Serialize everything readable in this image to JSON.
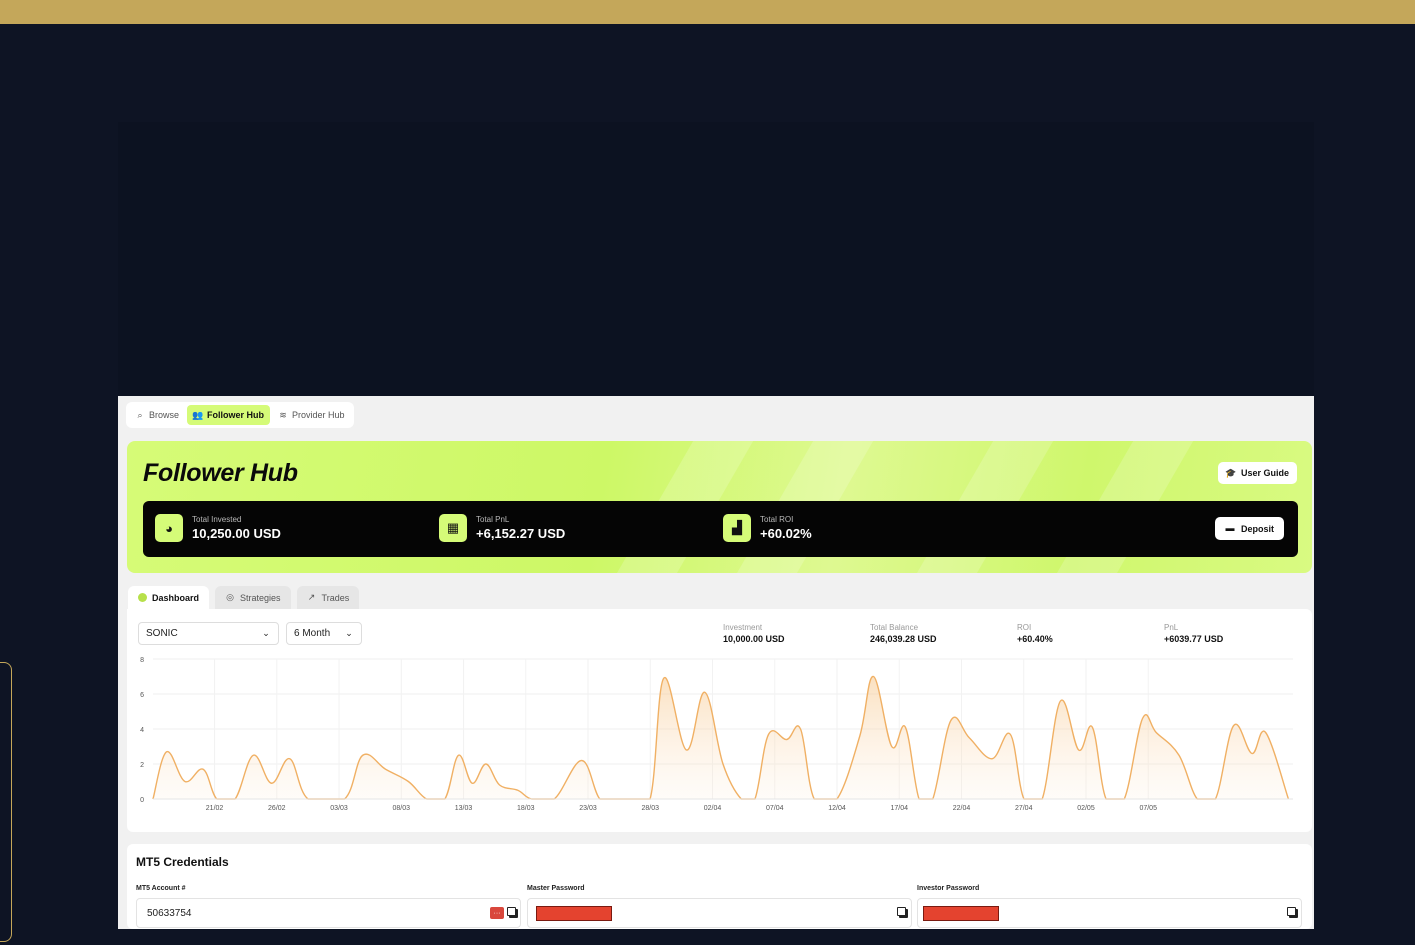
{
  "nav": {
    "tabs": [
      {
        "label": "Browse",
        "icon": "search-icon"
      },
      {
        "label": "Follower Hub",
        "icon": "users-icon"
      },
      {
        "label": "Provider Hub",
        "icon": "signal-icon"
      }
    ],
    "active_tab": "Follower Hub"
  },
  "hero": {
    "title": "Follower Hub",
    "guide_label": "User Guide",
    "deposit_label": "Deposit",
    "stats": [
      {
        "label": "Total Invested",
        "value": "10,250.00 USD",
        "icon": "pie-chart-icon"
      },
      {
        "label": "Total PnL",
        "value": "+6,152.27 USD",
        "icon": "calculator-icon"
      },
      {
        "label": "Total ROI",
        "value": "+60.02%",
        "icon": "bar-chart-icon"
      }
    ]
  },
  "subtabs": [
    {
      "label": "Dashboard",
      "icon": "dashboard-icon"
    },
    {
      "label": "Strategies",
      "icon": "target-icon"
    },
    {
      "label": "Trades",
      "icon": "trend-icon"
    }
  ],
  "dashboard": {
    "strategy_select": "SONIC",
    "period_select": "6 Month",
    "metrics": [
      {
        "label": "Investment",
        "value": "10,000.00 USD"
      },
      {
        "label": "Total Balance",
        "value": "246,039.28 USD"
      },
      {
        "label": "ROI",
        "value": "+60.40%"
      },
      {
        "label": "PnL",
        "value": "+6039.77 USD"
      }
    ]
  },
  "chart_data": {
    "type": "area",
    "y_ticks": [
      "0",
      "2",
      "4",
      "6",
      "8"
    ],
    "ylim": [
      0,
      8
    ],
    "x_ticks": [
      "21/02",
      "26/02",
      "03/03",
      "08/03",
      "13/03",
      "18/03",
      "23/03",
      "28/03",
      "02/04",
      "07/04",
      "12/04",
      "17/04",
      "22/04",
      "27/04",
      "02/05",
      "07/05"
    ],
    "grid": true,
    "color": "#f0b064",
    "points": [
      [
        0,
        0
      ],
      [
        0.3,
        2.7
      ],
      [
        0.7,
        1.0
      ],
      [
        1.1,
        1.7
      ],
      [
        1.4,
        0
      ],
      [
        1.8,
        0
      ],
      [
        2.2,
        2.5
      ],
      [
        2.6,
        0.9
      ],
      [
        3.0,
        2.3
      ],
      [
        3.4,
        0
      ],
      [
        4.2,
        0
      ],
      [
        4.6,
        2.5
      ],
      [
        5.1,
        1.7
      ],
      [
        5.6,
        1.0
      ],
      [
        6.0,
        0
      ],
      [
        6.4,
        0
      ],
      [
        6.7,
        2.5
      ],
      [
        7.0,
        0.9
      ],
      [
        7.3,
        2.0
      ],
      [
        7.6,
        0.8
      ],
      [
        8.0,
        0.5
      ],
      [
        8.3,
        0
      ],
      [
        8.8,
        0
      ],
      [
        9.4,
        2.2
      ],
      [
        9.8,
        0
      ],
      [
        10.2,
        0
      ],
      [
        10.4,
        0
      ],
      [
        10.9,
        0
      ],
      [
        11.2,
        6.9
      ],
      [
        11.7,
        2.8
      ],
      [
        12.1,
        6.1
      ],
      [
        12.5,
        2.0
      ],
      [
        12.9,
        0
      ],
      [
        13.2,
        0
      ],
      [
        13.5,
        3.7
      ],
      [
        13.9,
        3.4
      ],
      [
        14.2,
        4.0
      ],
      [
        14.5,
        0
      ],
      [
        15.0,
        0
      ],
      [
        15.5,
        3.6
      ],
      [
        15.8,
        7.0
      ],
      [
        16.2,
        3.0
      ],
      [
        16.5,
        4.1
      ],
      [
        16.8,
        0
      ],
      [
        17.1,
        0
      ],
      [
        17.5,
        4.5
      ],
      [
        17.9,
        3.5
      ],
      [
        18.4,
        2.3
      ],
      [
        18.8,
        3.7
      ],
      [
        19.1,
        0
      ],
      [
        19.5,
        0
      ],
      [
        19.9,
        5.6
      ],
      [
        20.3,
        2.8
      ],
      [
        20.6,
        4.1
      ],
      [
        20.9,
        0
      ],
      [
        21.3,
        0
      ],
      [
        21.7,
        4.6
      ],
      [
        22.0,
        3.8
      ],
      [
        22.5,
        2.5
      ],
      [
        22.9,
        0
      ],
      [
        23.3,
        0
      ],
      [
        23.7,
        4.2
      ],
      [
        24.1,
        2.6
      ],
      [
        24.4,
        3.8
      ],
      [
        24.9,
        0
      ]
    ]
  },
  "credentials": {
    "title": "MT5 Credentials",
    "fields": [
      {
        "label": "MT5 Account #",
        "value": "50633754"
      },
      {
        "label": "Master Password",
        "value": ""
      },
      {
        "label": "Investor Password",
        "value": ""
      }
    ],
    "toggle_badge": "···"
  }
}
